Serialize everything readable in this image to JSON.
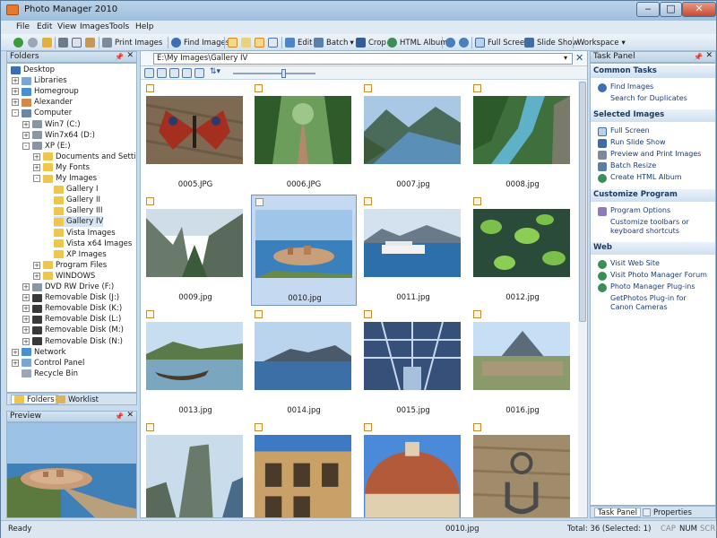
{
  "app": {
    "title": "Photo Manager 2010"
  },
  "window_controls": {
    "minimize": "‒",
    "maximize": "□",
    "close": "✕"
  },
  "menu": [
    "File",
    "Edit",
    "View",
    "Images",
    "Tools",
    "Help"
  ],
  "toolbar": {
    "print_images": "Print Images",
    "find_images": "Find Images",
    "edit": "Edit",
    "batch": "Batch",
    "crop": "Crop",
    "html_album": "HTML Album",
    "full_screen": "Full Screen",
    "slide_show": "Slide Show",
    "workspace": "Workspace"
  },
  "folders_pane": {
    "title": "Folders",
    "items": [
      "Desktop",
      "Libraries",
      "Homegroup",
      "Alexander",
      "Computer",
      "Win7 (C:)",
      "Win7x64 (D:)",
      "XP (E:)",
      "Documents and Settings",
      "My Fonts",
      "My Images",
      "Gallery I",
      "Gallery II",
      "Gallery III",
      "Gallery IV",
      "Vista Images",
      "Vista x64 Images",
      "XP Images",
      "Program Files",
      "WINDOWS",
      "DVD RW Drive (F:)",
      "Removable Disk (J:)",
      "Removable Disk (K:)",
      "Removable Disk (L:)",
      "Removable Disk (M:)",
      "Removable Disk (N:)",
      "Network",
      "Control Panel",
      "Recycle Bin"
    ],
    "tabs": [
      "Folders",
      "Worklist"
    ]
  },
  "preview_pane": {
    "title": "Preview"
  },
  "address": {
    "path": "E:\\My Images\\Gallery IV"
  },
  "thumbnails": [
    "0005.JPG",
    "0006.JPG",
    "0007.jpg",
    "0008.jpg",
    "0009.jpg",
    "0010.jpg",
    "0011.jpg",
    "0012.jpg",
    "0013.jpg",
    "0014.jpg",
    "0015.jpg",
    "0016.jpg",
    "",
    "",
    "",
    ""
  ],
  "selected_thumbnail": "0010.jpg",
  "task_panel": {
    "title": "Task Panel",
    "sections": {
      "common": "Common Tasks",
      "selected": "Selected Images",
      "customize": "Customize Program",
      "web": "Web"
    },
    "common_tasks": [
      "Find Images",
      "Search for Duplicates"
    ],
    "selected_images": [
      "Full Screen",
      "Run Slide Show",
      "Preview and Print Images",
      "Batch Resize",
      "Create HTML Album"
    ],
    "customize": [
      "Program Options",
      "Customize toolbars or keyboard shortcuts"
    ],
    "web": [
      "Visit Web Site",
      "Visit Photo Manager Forum",
      "Photo Manager Plug-ins",
      "GetPhotos Plug-in for Canon Cameras"
    ],
    "tabs": [
      "Task Panel",
      "Properties"
    ]
  },
  "status": {
    "ready": "Ready",
    "file": "0010.jpg",
    "total": "Total: 36 (Selected: 1)",
    "cap": "CAP",
    "num": "NUM",
    "scrl": "SCRL"
  }
}
